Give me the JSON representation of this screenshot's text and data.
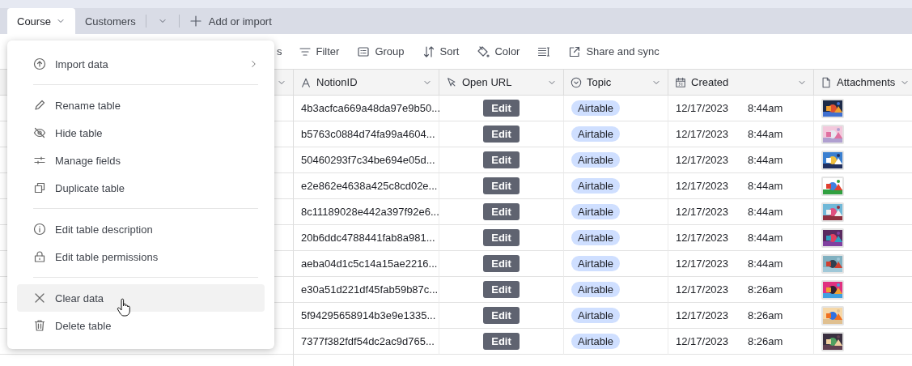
{
  "tabs": [
    {
      "label": "Course",
      "selected": true,
      "dropdown": true
    },
    {
      "label": "Customers",
      "selected": false,
      "dropdown": false
    }
  ],
  "add_button": {
    "label": "Add or import"
  },
  "toolbar": [
    {
      "label": "s",
      "kind": "text"
    },
    {
      "label": "Filter",
      "kind": "filter"
    },
    {
      "label": "Group",
      "kind": "group"
    },
    {
      "label": "Sort",
      "kind": "sort"
    },
    {
      "label": "Color",
      "kind": "color"
    },
    {
      "kind": "row-height"
    },
    {
      "label": "Share and sync",
      "kind": "share"
    }
  ],
  "table": {
    "columns": [
      {
        "label": "NotionID",
        "kind": "text"
      },
      {
        "label": "Open URL",
        "kind": "button"
      },
      {
        "label": "Topic",
        "kind": "select"
      },
      {
        "label": "Created",
        "kind": "date"
      },
      {
        "label": "Attachments",
        "kind": "attachment"
      }
    ],
    "rows": [
      {
        "notion_id": "4b3acfca669a48da97e9b50...",
        "open_url": "Edit",
        "topic": "Airtable",
        "date": "12/17/2023",
        "time": "8:44am"
      },
      {
        "notion_id": "b5763c0884d74fa99a4604...",
        "open_url": "Edit",
        "topic": "Airtable",
        "date": "12/17/2023",
        "time": "8:44am"
      },
      {
        "notion_id": "50460293f7c34be694e05d...",
        "open_url": "Edit",
        "topic": "Airtable",
        "date": "12/17/2023",
        "time": "8:44am"
      },
      {
        "notion_id": "e2e862e4638a425c8cd02e...",
        "open_url": "Edit",
        "topic": "Airtable",
        "date": "12/17/2023",
        "time": "8:44am"
      },
      {
        "notion_id": "8c11189028e442a397f92e6...",
        "open_url": "Edit",
        "topic": "Airtable",
        "date": "12/17/2023",
        "time": "8:44am"
      },
      {
        "notion_id": "20b6ddc4788441fab8a981...",
        "open_url": "Edit",
        "topic": "Airtable",
        "date": "12/17/2023",
        "time": "8:44am"
      },
      {
        "notion_id": "aeba04d1c5c14a15ae2216...",
        "open_url": "Edit",
        "topic": "Airtable",
        "date": "12/17/2023",
        "time": "8:44am"
      },
      {
        "notion_id": "e30a51d221df45fab59b87c...",
        "open_url": "Edit",
        "topic": "Airtable",
        "date": "12/17/2023",
        "time": "8:26am"
      },
      {
        "notion_id": "5f94295658914b3e9e1335...",
        "open_url": "Edit",
        "topic": "Airtable",
        "date": "12/17/2023",
        "time": "8:26am"
      },
      {
        "notion_id": "7377f382fdf54dc2ac9d765...",
        "open_url": "Edit",
        "topic": "Airtable",
        "date": "12/17/2023",
        "time": "8:26am"
      }
    ]
  },
  "menu": {
    "groups": [
      [
        {
          "label": "Import data",
          "submenu": true,
          "highlighted": false
        }
      ],
      [
        {
          "label": "Rename table",
          "submenu": false,
          "highlighted": false
        },
        {
          "label": "Hide table",
          "submenu": false,
          "highlighted": false
        },
        {
          "label": "Manage fields",
          "submenu": false,
          "highlighted": false
        },
        {
          "label": "Duplicate table",
          "submenu": false,
          "highlighted": false
        }
      ],
      [
        {
          "label": "Edit table description",
          "submenu": false,
          "highlighted": false
        },
        {
          "label": "Edit table permissions",
          "submenu": false,
          "highlighted": false
        }
      ],
      [
        {
          "label": "Clear data",
          "submenu": false,
          "highlighted": true
        },
        {
          "label": "Delete table",
          "submenu": false,
          "highlighted": false
        }
      ]
    ]
  }
}
